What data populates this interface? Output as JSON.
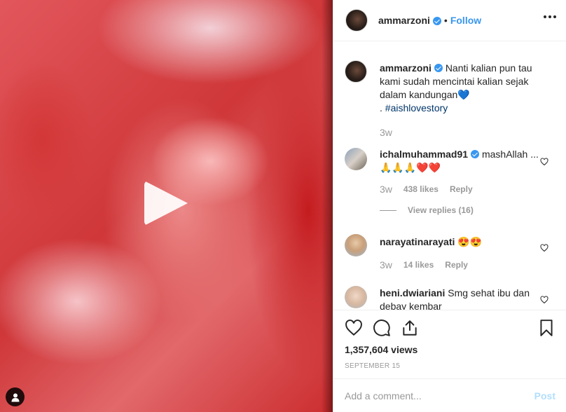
{
  "header": {
    "username": "ammarzoni",
    "separator": "•",
    "follow_label": "Follow"
  },
  "caption": {
    "username": "ammarzoni",
    "text": "Nanti kalian pun tau kami sudah mencintai kalian sejak dalam kandungan💙",
    "hashtag_prefix": ". ",
    "hashtag": "#aishlovestory",
    "time": "3w"
  },
  "comments": [
    {
      "username": "ichalmuhammad91",
      "text": "mashAllah ...🙏🙏🙏❤️❤️",
      "time": "3w",
      "likes": "438 likes",
      "reply_label": "Reply",
      "view_replies": "View replies (16)"
    },
    {
      "username": "narayatinarayati",
      "text": "😍😍",
      "time": "3w",
      "likes": "14 likes",
      "reply_label": "Reply"
    },
    {
      "username": "heni.dwiariani",
      "text": "Smg sehat ibu dan debay kembar"
    }
  ],
  "stats": {
    "views": "1,357,604 views",
    "date": "SEPTEMBER 15"
  },
  "composer": {
    "placeholder": "Add a comment...",
    "post_label": "Post"
  },
  "colors": {
    "accent": "#3897f0",
    "hashtag": "#003569",
    "muted": "#999999",
    "post_disabled": "#b2dffc"
  },
  "icons": [
    "play-icon",
    "user-tag-icon",
    "verified-badge-icon",
    "more-options-icon",
    "heart-icon",
    "comment-icon",
    "share-icon",
    "bookmark-icon"
  ]
}
